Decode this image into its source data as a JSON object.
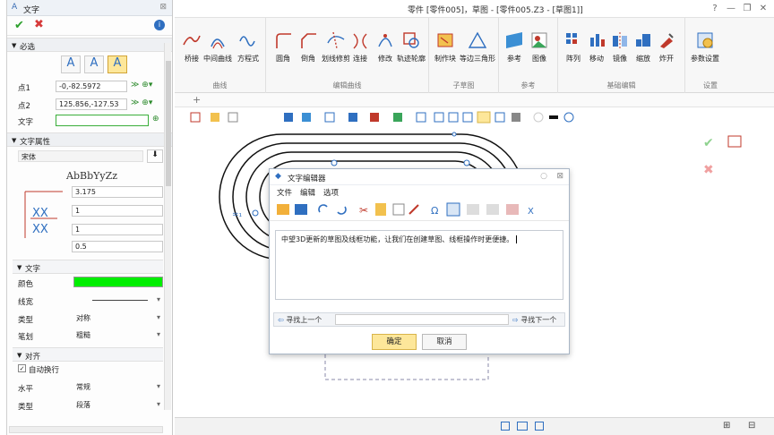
{
  "window": {
    "title": "零件 [零件005]，草图 - [零件005.Z3 - [草图1]]"
  },
  "ribbon": {
    "groups": [
      {
        "name": "曲线",
        "buttons": [
          "桥接",
          "中间曲线",
          "方程式"
        ]
      },
      {
        "name": "编辑曲线",
        "buttons": [
          "圆角",
          "倒角",
          "划线修剪",
          "连接",
          "修改",
          "轨迹轮廓"
        ]
      },
      {
        "name": "子草图",
        "buttons": [
          "制作块",
          "等边三角形"
        ]
      },
      {
        "name": "参考",
        "buttons": [
          "参考",
          "图像"
        ]
      },
      {
        "name": "基础编辑",
        "buttons": [
          "阵列",
          "移动",
          "镜像",
          "缩放",
          "炸开"
        ]
      },
      {
        "name": "设置",
        "buttons": [
          "参数设置"
        ]
      }
    ]
  },
  "panel": {
    "title": "文字",
    "sections": {
      "required": "必选",
      "text_props": "文字属性",
      "text": "文字",
      "align": "对齐"
    },
    "point1_label": "点1",
    "point1_value": "-0,-82.5972",
    "point2_label": "点2",
    "point2_value": "125.856,-127.53",
    "text_label": "文字",
    "text_value": "",
    "font_value": "宋体",
    "font_preview": "AbBbYyZz",
    "height_value": "3.175",
    "val2": "1",
    "val3": "1",
    "val4": "0.5",
    "color_label": "颜色",
    "color_value": "#00ee00",
    "linewidth_label": "线宽",
    "type_label": "类型",
    "type_value": "对称",
    "stroke_label": "笔划",
    "stroke_value": "粗糙",
    "autowrap_label": "自动换行",
    "horiz_label": "水平",
    "horiz_value": "常规",
    "type2_label": "类型",
    "type2_value": "段落"
  },
  "canvas": {
    "dim_label": "=₁"
  },
  "dialog": {
    "title": "文字编辑器",
    "menu": [
      "文件",
      "编辑",
      "选项"
    ],
    "content": "中望3D更新的草图及线框功能，让我们在创建草图、线框操作时更便捷。",
    "find_prev": "寻找上一个",
    "find_next": "寻找下一个",
    "ok": "确定",
    "cancel": "取消"
  }
}
